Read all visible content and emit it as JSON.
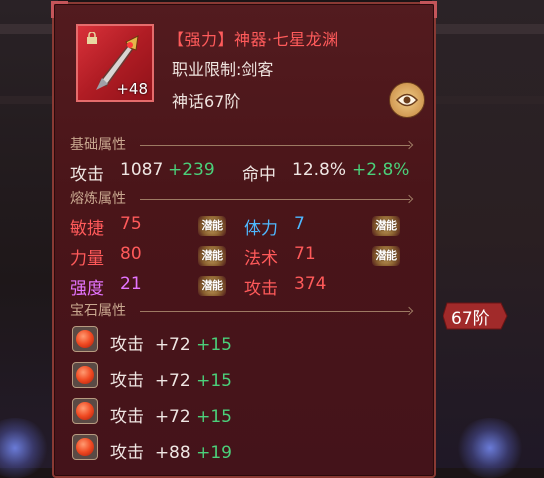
{
  "item": {
    "name": "【强力】神器·七星龙渊",
    "restriction": "职业限制:剑客",
    "tier_text": "神话67阶",
    "enhance": "+48"
  },
  "sections": {
    "base": "基础属性",
    "refine": "熔炼属性",
    "gem": "宝石属性"
  },
  "base_stats": {
    "attack_label": "攻击",
    "attack_value": "1087",
    "attack_bonus": "+239",
    "hit_label": "命中",
    "hit_value": "12.8%",
    "hit_bonus": "+2.8%"
  },
  "refine_stats": [
    {
      "label": "敏捷",
      "value": "75",
      "potential": "潜能",
      "color": "#ff5a5a"
    },
    {
      "label": "体力",
      "value": "7",
      "potential": "潜能",
      "color": "#4eb8ff"
    },
    {
      "label": "力量",
      "value": "80",
      "potential": "潜能",
      "color": "#ff5a5a"
    },
    {
      "label": "法术",
      "value": "71",
      "potential": "潜能",
      "color": "#ff5a5a"
    },
    {
      "label": "强度",
      "value": "21",
      "potential": "潜能",
      "color": "#e574ff"
    },
    {
      "label": "攻击",
      "value": "374",
      "color": "#ff5a5a"
    }
  ],
  "gems": [
    {
      "label": "攻击",
      "value": "+72",
      "bonus": "+15"
    },
    {
      "label": "攻击",
      "value": "+72",
      "bonus": "+15"
    },
    {
      "label": "攻击",
      "value": "+72",
      "bonus": "+15"
    },
    {
      "label": "攻击",
      "value": "+88",
      "bonus": "+19"
    }
  ],
  "side_badge": "67阶",
  "icons": [
    "lock-icon",
    "eye-icon",
    "sword-icon",
    "gem-icon"
  ]
}
